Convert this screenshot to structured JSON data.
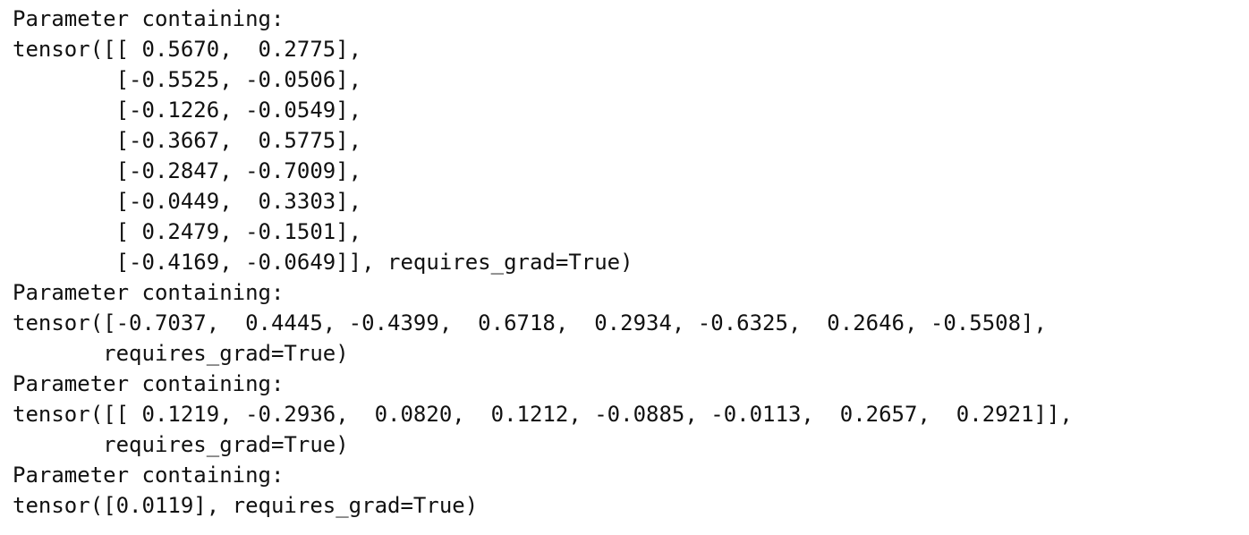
{
  "output": {
    "lines": [
      "Parameter containing:",
      "tensor([[ 0.5670,  0.2775],",
      "        [-0.5525, -0.0506],",
      "        [-0.1226, -0.0549],",
      "        [-0.3667,  0.5775],",
      "        [-0.2847, -0.7009],",
      "        [-0.0449,  0.3303],",
      "        [ 0.2479, -0.1501],",
      "        [-0.4169, -0.0649]], requires_grad=True)",
      "Parameter containing:",
      "tensor([-0.7037,  0.4445, -0.4399,  0.6718,  0.2934, -0.6325,  0.2646, -0.5508],",
      "       requires_grad=True)",
      "Parameter containing:",
      "tensor([[ 0.1219, -0.2936,  0.0820,  0.1212, -0.0885, -0.0113,  0.2657,  0.2921]],",
      "       requires_grad=True)",
      "Parameter containing:",
      "tensor([0.0119], requires_grad=True)"
    ]
  }
}
